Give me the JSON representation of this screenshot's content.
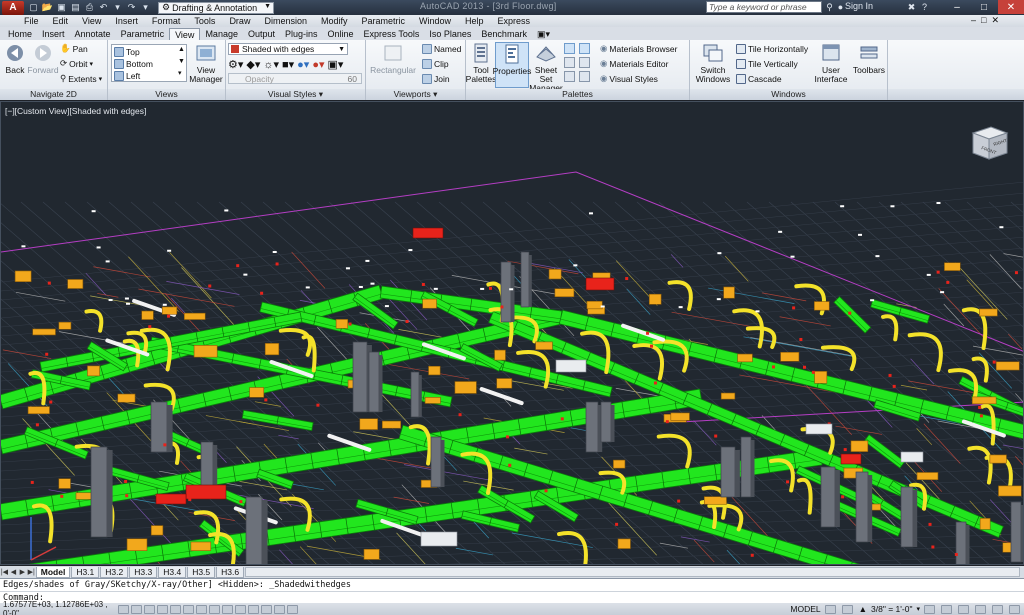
{
  "titlebar": {
    "app_button": "A",
    "workspace": "Drafting & Annotation",
    "window_title": "AutoCAD 2013 - [3rd Floor.dwg]",
    "search_placeholder": "Type a keyword or phrase",
    "sign_in": "Sign In"
  },
  "menu": [
    "File",
    "Edit",
    "View",
    "Insert",
    "Format",
    "Tools",
    "Draw",
    "Dimension",
    "Modify",
    "Parametric",
    "Window",
    "Help",
    "Express"
  ],
  "tabs": [
    "Home",
    "Insert",
    "Annotate",
    "Parametric",
    "View",
    "Manage",
    "Output",
    "Plug-ins",
    "Online",
    "Express Tools",
    "Iso Planes",
    "Benchmark"
  ],
  "active_tab": "View",
  "ribbon": {
    "navigate": {
      "title": "Navigate 2D",
      "back": "Back",
      "forward": "Forward",
      "pan": "Pan",
      "orbit": "Orbit",
      "extents": "Extents"
    },
    "views": {
      "title": "Views",
      "items": [
        "Top",
        "Bottom",
        "Left"
      ],
      "view_manager": "View Manager"
    },
    "visual_styles": {
      "title": "Visual Styles",
      "current": "Shaded with edges",
      "opacity_label": "Opacity",
      "opacity_value": "60"
    },
    "viewports": {
      "title": "Viewports",
      "rectangular": "Rectangular",
      "named": "Named",
      "clip": "Clip",
      "join": "Join"
    },
    "palettes": {
      "title": "Palettes",
      "tool_palettes": "Tool Palettes",
      "properties": "Properties",
      "sheet_set_manager": "Sheet Set Manager",
      "materials_browser": "Materials Browser",
      "materials_editor": "Materials Editor",
      "visual_styles": "Visual Styles"
    },
    "windows": {
      "title": "Windows",
      "switch_windows": "Switch Windows",
      "tile_horizontally": "Tile Horizontally",
      "tile_vertically": "Tile Vertically",
      "cascade": "Cascade",
      "user_interface": "User Interface",
      "toolbars": "Toolbars"
    }
  },
  "viewport": {
    "label": "[−][Custom View][Shaded with edges]",
    "viewcube_front": "FRONT",
    "viewcube_right": "RIGHT"
  },
  "layout_tabs": [
    "Model",
    "H3.1",
    "H3.2",
    "H3.3",
    "H3.4",
    "H3.5",
    "H3.6"
  ],
  "active_layout": "Model",
  "command": {
    "history": "Edges/shades of Gray/SKetchy/X-ray/Other] <Hidden>: _Shadedwithedges",
    "prompt": "Command:"
  },
  "status": {
    "coords": "1.67577E+03, 1.12786E+03 , 0'-0\"",
    "model": "MODEL",
    "scale": "3/8\" = 1'-0\""
  },
  "colors": {
    "viewport_bg": "#212830",
    "duct": "#22e61e",
    "flex": "#f4e22a",
    "diffuser": "#f2a81c",
    "accent": "#e8231b"
  }
}
